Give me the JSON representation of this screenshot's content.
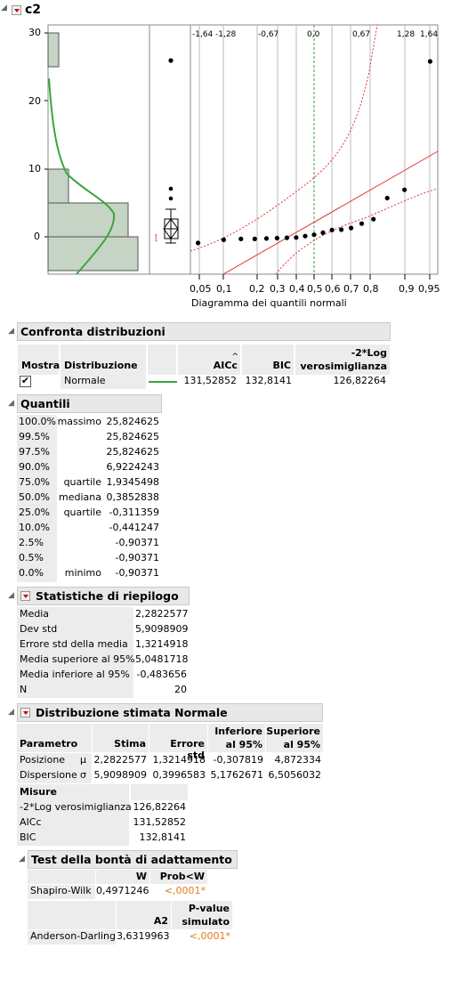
{
  "title": "c2",
  "plot": {
    "y_ticks": [
      "30",
      "20",
      "10",
      "0"
    ],
    "top_z_labels": [
      "-1,64",
      "-1,28",
      "-0,67",
      "0,0",
      "0,67",
      "1,28",
      "1,64"
    ],
    "prob_ticks": [
      "0,05",
      "0,1",
      "0,2",
      "0,3",
      "0,4",
      "0,5",
      "0,6",
      "0,7",
      "0,8",
      "0,9",
      "0,95"
    ],
    "axis_title": "Diagramma dei quantili normali",
    "box_marker": "[",
    "colors": {
      "hist": "#c5d4c5",
      "curve": "#3aa63a",
      "line": "#e03535",
      "ref": "#3aa63a"
    }
  },
  "chart_data": {
    "type": "scatter",
    "xlabel": "Diagramma dei quantili normali",
    "values": [
      -0.90371,
      -0.441247,
      -0.311359,
      -0.311359,
      -0.25,
      -0.2,
      -0.15,
      -0.1,
      0.1,
      0.3,
      0.6,
      1.0,
      1.05,
      1.3,
      1.9345498,
      2.6,
      5.7,
      6.9224243,
      25.824625
    ],
    "ylim": [
      -5,
      30
    ]
  },
  "compare": {
    "title": "Confronta distribuzioni",
    "headers": {
      "mostra": "Mostra",
      "distribuzione": "Distribuzione",
      "aicc": "AICc",
      "bic": "BIC",
      "loglik1": "-2*Log",
      "loglik2": "verosimiglianza"
    },
    "row": {
      "name": "Normale",
      "aicc": "131,52852",
      "bic": "132,8141",
      "loglik": "126,82264",
      "checked": true
    }
  },
  "quantili": {
    "title": "Quantili",
    "rows": [
      {
        "pct": "100.0%",
        "label": "massimo",
        "value": "25,824625"
      },
      {
        "pct": "99.5%",
        "label": "",
        "value": "25,824625"
      },
      {
        "pct": "97.5%",
        "label": "",
        "value": "25,824625"
      },
      {
        "pct": "90.0%",
        "label": "",
        "value": "6,9224243"
      },
      {
        "pct": "75.0%",
        "label": "quartile",
        "value": "1,9345498"
      },
      {
        "pct": "50.0%",
        "label": "mediana",
        "value": "0,3852838"
      },
      {
        "pct": "25.0%",
        "label": "quartile",
        "value": "-0,311359"
      },
      {
        "pct": "10.0%",
        "label": "",
        "value": "-0,441247"
      },
      {
        "pct": "2.5%",
        "label": "",
        "value": "-0,90371"
      },
      {
        "pct": "0.5%",
        "label": "",
        "value": "-0,90371"
      },
      {
        "pct": "0.0%",
        "label": "minimo",
        "value": "-0,90371"
      }
    ]
  },
  "stats": {
    "title": "Statistiche di riepilogo",
    "rows": [
      {
        "label": "Media",
        "value": "2,2822577"
      },
      {
        "label": "Dev std",
        "value": "5,9098909"
      },
      {
        "label": "Errore std della media",
        "value": "1,3214918"
      },
      {
        "label": "Media superiore al 95%",
        "value": "5,0481718"
      },
      {
        "label": "Media inferiore al 95%",
        "value": "-0,483656"
      },
      {
        "label": "N",
        "value": "20"
      }
    ]
  },
  "fit": {
    "title": "Distribuzione stimata Normale",
    "headers": {
      "param": "Parametro",
      "stima": "Stima",
      "err": "Errore std",
      "inf1": "Inferiore",
      "inf2": "al 95%",
      "sup1": "Superiore",
      "sup2": "al 95%"
    },
    "rows": [
      {
        "name": "Posizione",
        "sym": "μ",
        "stima": "2,2822577",
        "err": "1,3214918",
        "inf": "-0,307819",
        "sup": "4,872334"
      },
      {
        "name": "Dispersione",
        "sym": "σ",
        "stima": "5,9098909",
        "err": "0,3996583",
        "inf": "5,1762671",
        "sup": "6,5056032"
      }
    ],
    "misure_title": "Misure",
    "misure": [
      {
        "label": "-2*Log verosimiglianza",
        "value": "126,82264"
      },
      {
        "label": "AICc",
        "value": "131,52852"
      },
      {
        "label": "BIC",
        "value": "132,8141"
      }
    ]
  },
  "gof": {
    "title": "Test della bontà di adattamento",
    "sw": {
      "h_w": "W",
      "h_prob": "Prob<W",
      "name": "Shapiro-Wilk",
      "w": "0,4971246",
      "prob": "<,0001*"
    },
    "ad": {
      "h_a2": "A2",
      "h_p1": "P-value",
      "h_p2": "simulato",
      "name": "Anderson-Darling",
      "a2": "3,6319963",
      "p": "<,0001*"
    }
  }
}
